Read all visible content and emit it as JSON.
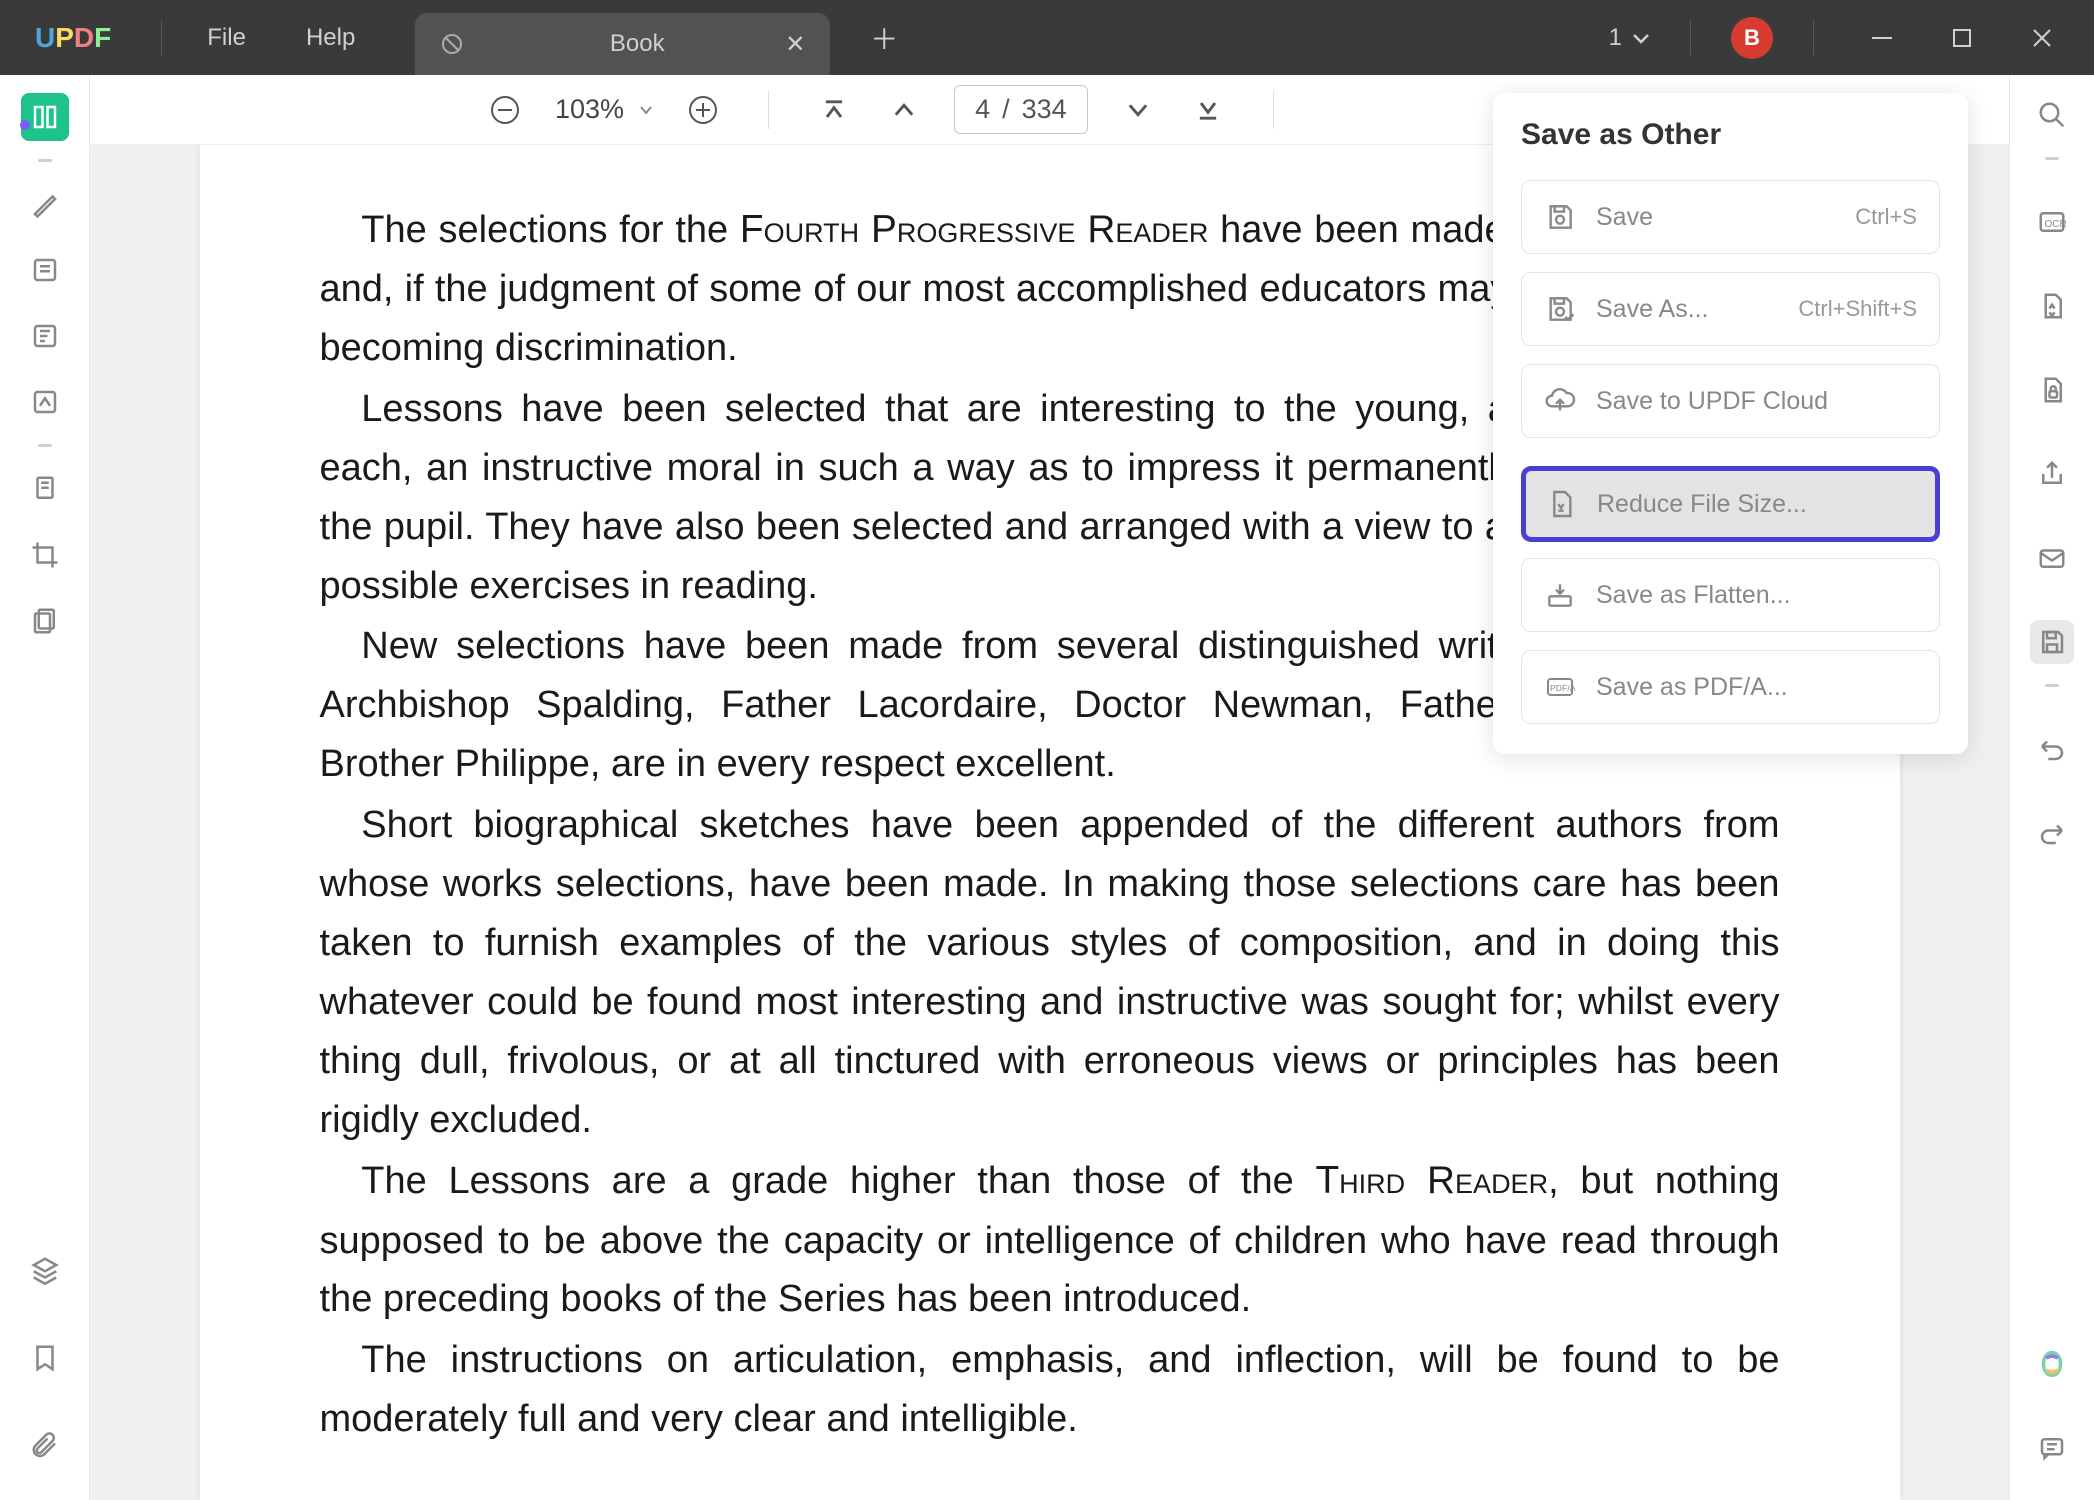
{
  "app": {
    "logo": {
      "u": "U",
      "p": "P",
      "d": "D",
      "f": "F"
    },
    "menus": {
      "file": "File",
      "help": "Help"
    },
    "tab": {
      "title": "Book"
    },
    "tabCount": "1",
    "avatar": "B"
  },
  "toolbar": {
    "zoom": "103%",
    "page": {
      "current": "4",
      "sep": "/",
      "total": "334"
    }
  },
  "document": {
    "p1": "The selections for the Fourth Progressive Reader have been made with great care, and, if the judgment of some of our most accomplished educators may be trusted, with becoming discrimination.",
    "p2": "Lessons have been selected that are interesting to the young, and that convey, each, an instructive moral in such a way as to impress it permanently on the mind of the pupil. They have also been selected and arranged with a view to affording the best possible exercises in reading.",
    "p3": "New selections have been made from several distinguished writers. Those from Archbishop Spalding, Father Lacordaire, Doctor Newman, Father Hoffman, and Brother Philippe, are in every respect excellent.",
    "p4": "Short biographical sketches have been appended of the different authors from whose works selections, have been made. In making those selections care has been taken to furnish examples of the various styles of composition, and in doing this whatever could be found most interesting and instructive was sought for; whilst every thing dull, frivolous, or at all tinctured with erroneous views or principles has been rigidly excluded.",
    "p5": "The Lessons are a grade higher than those of the Third Reader, but nothing supposed to be above the capacity or intelligence of children who have read through the preceding books of the Series has been introduced.",
    "p6": "The instructions on articulation, emphasis, and inflection, will be found to be moderately full and very clear and intelligible."
  },
  "savePanel": {
    "title": "Save as Other",
    "items": {
      "save": {
        "label": "Save",
        "shortcut": "Ctrl+S"
      },
      "saveAs": {
        "label": "Save As...",
        "shortcut": "Ctrl+Shift+S"
      },
      "cloud": {
        "label": "Save to UPDF Cloud"
      },
      "reduce": {
        "label": "Reduce File Size..."
      },
      "flatten": {
        "label": "Save as Flatten..."
      },
      "pdfa": {
        "label": "Save as PDF/A..."
      }
    }
  }
}
